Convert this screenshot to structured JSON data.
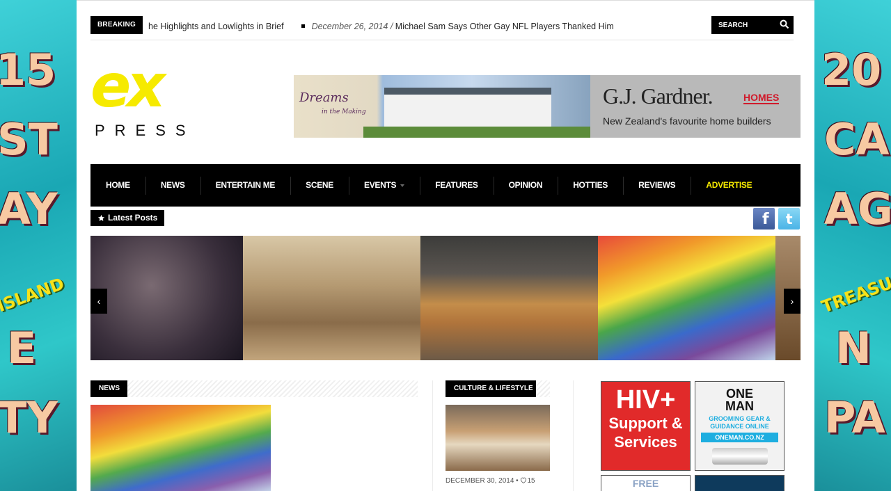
{
  "topbar": {
    "breaking_label": "BREAKING",
    "ticker": [
      {
        "date": "",
        "headline": "he Highlights and Lowlights in Brief"
      },
      {
        "date": "December 26, 2014",
        "separator": " / ",
        "headline": "Michael Sam Says Other Gay NFL Players Thanked Him"
      }
    ],
    "search_placeholder": "SEARCH"
  },
  "logo": {
    "mark": "ex",
    "word": "PRESS",
    "color": "#f6ea00"
  },
  "banner_ad": {
    "left_text": "Dreams",
    "left_sub": "in the Making",
    "brand": "G.J. Gardner.",
    "brand_tag": "HOMES",
    "tagline": "New Zealand's favourite home builders"
  },
  "nav": {
    "items": [
      {
        "label": "HOME"
      },
      {
        "label": "NEWS"
      },
      {
        "label": "ENTERTAIN ME"
      },
      {
        "label": "SCENE"
      },
      {
        "label": "EVENTS",
        "has_dropdown": true
      },
      {
        "label": "FEATURES"
      },
      {
        "label": "OPINION"
      },
      {
        "label": "HOTTIES"
      },
      {
        "label": "REVIEWS"
      },
      {
        "label": "ADVERTISE",
        "accent": true
      }
    ],
    "accent_color": "#f6ea00"
  },
  "latest_posts": {
    "label": "Latest Posts",
    "icon": "star-icon"
  },
  "social": {
    "facebook_letter": "f",
    "twitter_letter": "t"
  },
  "slider": {
    "prev": "‹",
    "next": "›"
  },
  "sections": {
    "news": {
      "label": "NEWS"
    },
    "culture": {
      "label": "CULTURE & LIFESTYLE",
      "meta_date": "DECEMBER 30, 2014",
      "meta_sep": "•",
      "likes": "15"
    }
  },
  "ads": {
    "hiv_line1": "HIV+",
    "hiv_line2": "Support &",
    "hiv_line3": "Services",
    "oneman_brand1": "ONE",
    "oneman_brand2": "MAN",
    "oneman_sub1": "GROOMING GEAR &",
    "oneman_sub2": "GUIDANCE ONLINE",
    "oneman_url": "ONEMAN.CO.NZ",
    "free_label": "FREE"
  },
  "skins": {
    "left_text": [
      "15",
      "ST",
      "AY",
      "ISLAND",
      "E",
      "TY"
    ],
    "right_text": [
      "20",
      "CA",
      "AG",
      "TREASU",
      "N",
      "PA"
    ]
  }
}
